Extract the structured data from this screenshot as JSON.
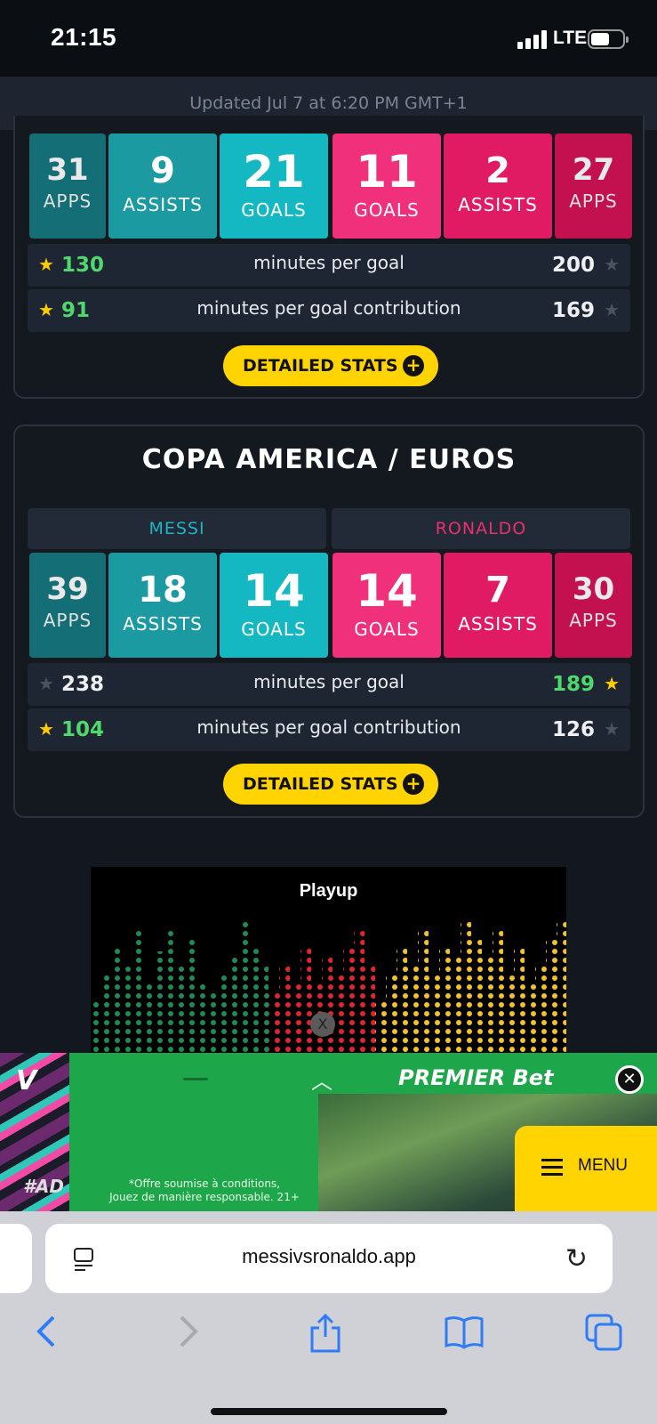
{
  "status": {
    "time": "21:15",
    "network": "LTE"
  },
  "updated": "Updated Jul 7 at 6:20 PM GMT+1",
  "card1": {
    "messi_tiles": [
      {
        "num": "31",
        "label": "APPS"
      },
      {
        "num": "9",
        "label": "ASSISTS"
      },
      {
        "num": "21",
        "label": "GOALS"
      }
    ],
    "ronaldo_tiles": [
      {
        "num": "11",
        "label": "GOALS"
      },
      {
        "num": "2",
        "label": "ASSISTS"
      },
      {
        "num": "27",
        "label": "APPS"
      }
    ],
    "rows": [
      {
        "left": "130",
        "label": "minutes per goal",
        "right": "200"
      },
      {
        "left": "91",
        "label": "minutes per goal contribution",
        "right": "169"
      }
    ],
    "button": "DETAILED STATS"
  },
  "card2": {
    "title": "COPA AMERICA / EUROS",
    "messi_name": "MESSI",
    "ronaldo_name": "RONALDO",
    "messi_tiles": [
      {
        "num": "39",
        "label": "APPS"
      },
      {
        "num": "18",
        "label": "ASSISTS"
      },
      {
        "num": "14",
        "label": "GOALS"
      }
    ],
    "ronaldo_tiles": [
      {
        "num": "14",
        "label": "GOALS"
      },
      {
        "num": "7",
        "label": "ASSISTS"
      },
      {
        "num": "30",
        "label": "APPS"
      }
    ],
    "rows": [
      {
        "left": "238",
        "label": "minutes per goal",
        "right": "189"
      },
      {
        "left": "104",
        "label": "minutes per goal contribution",
        "right": "126"
      }
    ],
    "button": "DETAILED STATS"
  },
  "ad": {
    "brand": "Playup",
    "close": "X"
  },
  "banner": {
    "v": "V",
    "brand": "PREMIER Bet",
    "legal_1": "*Offre soumise à conditions,",
    "legal_2": "Jouez de manière responsable. 21+",
    "ad_tag": "#AD",
    "menu_label": "MENU"
  },
  "browser": {
    "url": "messivsronaldo.app"
  },
  "colors": {
    "messi": "#1fb5c2",
    "ronaldo": "#e8316f",
    "button": "#ffd400",
    "better": "#4fd86b"
  },
  "icons": [
    "star-icon",
    "plus-icon",
    "close-icon",
    "chevron-up-icon",
    "hamburger-icon",
    "reader-icon",
    "reload-icon",
    "back-icon",
    "forward-icon",
    "share-icon",
    "bookmarks-icon",
    "tabs-icon"
  ]
}
